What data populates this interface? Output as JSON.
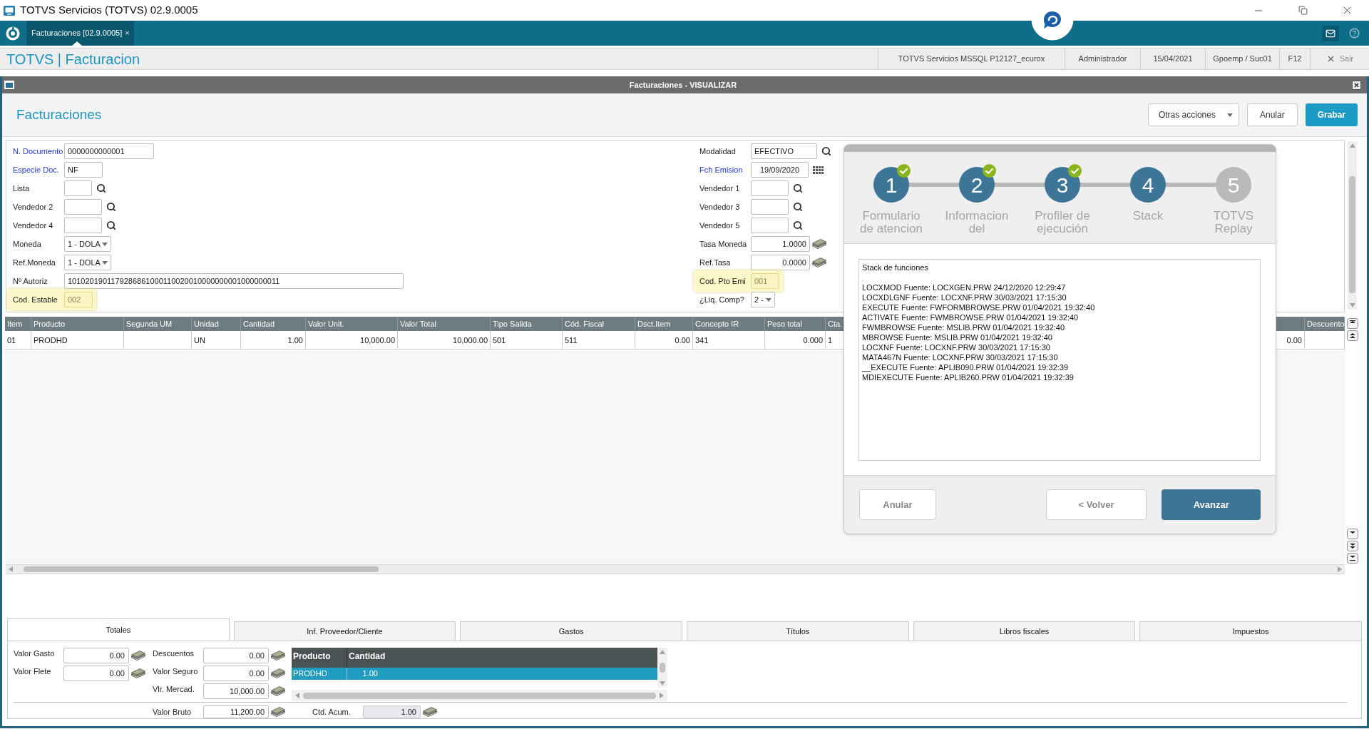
{
  "window": {
    "title": "TOTVS Servicios (TOTVS) 02.9.0005"
  },
  "app_tabs": [
    {
      "label": "Facturaciones [02.9.0005]",
      "close": "×",
      "selected": true
    }
  ],
  "app_header": {
    "title": "TOTVS | Facturacion",
    "info": [
      "TOTVS Servicios MSSQL P12127_ecurox",
      "Administrador",
      "15/04/2021",
      "Gpoemp / Suc01",
      "F12"
    ],
    "exit": "Sair"
  },
  "dialog": {
    "title": "Facturaciones - VISUALIZAR"
  },
  "page_header": {
    "title": "Facturaciones",
    "buttons": [
      {
        "label": "Otras acciones",
        "kind": "menu"
      },
      {
        "label": "Anular",
        "kind": "default"
      },
      {
        "label": "Grabar",
        "kind": "primary"
      }
    ]
  },
  "form": {
    "left": [
      {
        "label": "N. Documento",
        "value": "0000000000001",
        "kind": "text",
        "required": true,
        "highlighted": false
      },
      {
        "label": "Especie Doc.",
        "value": "NF",
        "kind": "text",
        "required": true,
        "highlighted": false
      },
      {
        "label": "Lista",
        "kind": "lookup",
        "required": false,
        "highlighted": false
      },
      {
        "label": "Vendedor 2",
        "kind": "lookup",
        "required": false,
        "highlighted": false
      },
      {
        "label": "Vendedor 4",
        "kind": "lookup",
        "required": false,
        "highlighted": false
      },
      {
        "label": "Moneda",
        "value": "1 - DOLA",
        "kind": "select",
        "required": false,
        "highlighted": false
      },
      {
        "label": "Ref.Moneda",
        "value": "1 - DOLA",
        "kind": "select",
        "required": false,
        "highlighted": false
      },
      {
        "label": "Nº Autoriz",
        "value": "1010201901179286861000110020010000000001000000011",
        "kind": "text",
        "required": false,
        "highlighted": false
      },
      {
        "label": "Cod. Estable",
        "value": "002",
        "kind": "text",
        "required": false,
        "highlighted": true
      }
    ],
    "right": [
      {
        "label": "Modalidad",
        "value": "EFECTIVO",
        "kind": "lookup",
        "required": false,
        "highlighted": false
      },
      {
        "label": "Fch Emision",
        "value": "19/09/2020",
        "kind": "date",
        "required": true,
        "highlighted": false
      },
      {
        "label": "Vendedor 1",
        "kind": "lookup",
        "required": false,
        "highlighted": false
      },
      {
        "label": "Vendedor 3",
        "kind": "lookup",
        "required": false,
        "highlighted": false
      },
      {
        "label": "Vendedor 5",
        "kind": "lookup",
        "required": false,
        "highlighted": false
      },
      {
        "label": "Tasa Moneda",
        "value": "1.0000",
        "kind": "amount",
        "required": false,
        "highlighted": false
      },
      {
        "label": "Ref.Tasa",
        "value": "0.0000",
        "kind": "amount",
        "required": false,
        "highlighted": false
      },
      {
        "label": "Cod. Pto Emi",
        "value": "001",
        "kind": "text",
        "required": false,
        "highlighted": true
      },
      {
        "label": "¿Liq. Comp?",
        "value": "2 -",
        "kind": "select",
        "required": false,
        "highlighted": false
      }
    ]
  },
  "items_table": {
    "columns": [
      {
        "label": "Item",
        "kind": "text"
      },
      {
        "label": "Producto",
        "kind": "text"
      },
      {
        "label": "Segunda UM",
        "kind": "text"
      },
      {
        "label": "Unidad",
        "kind": "text"
      },
      {
        "label": "Cantidad",
        "kind": "number"
      },
      {
        "label": "Valor Unit.",
        "kind": "number"
      },
      {
        "label": "Valor Total",
        "kind": "number"
      },
      {
        "label": "Tipo Salida",
        "kind": "text"
      },
      {
        "label": "Cód. Fiscal",
        "kind": "text"
      },
      {
        "label": "Dsct.Item",
        "kind": "number"
      },
      {
        "label": "Concepto IR",
        "kind": "text"
      },
      {
        "label": "Peso total",
        "kind": "number"
      },
      {
        "label": "Cta.",
        "kind": "text"
      },
      {
        "kind": "number"
      },
      {
        "label": "Descuento",
        "kind": "number"
      }
    ],
    "rows": [
      [
        "01",
        "PRODHD",
        null,
        "UN",
        "1.00",
        "10,000.00",
        "10,000.00",
        "501",
        "511",
        "0.00",
        "341",
        "0.000",
        "1",
        "0.00",
        null
      ]
    ]
  },
  "bottom_tabs": [
    {
      "label": "Totales",
      "selected": true
    },
    {
      "label": "Inf. Proveedor/Cliente",
      "selected": false
    },
    {
      "label": "Gastos",
      "selected": false
    },
    {
      "label": "Títulos",
      "selected": false
    },
    {
      "label": "Libros fiscales",
      "selected": false
    },
    {
      "label": "Impuestos",
      "selected": false
    }
  ],
  "totals": {
    "left": [
      {
        "label": "Valor Gasto",
        "value": "0.00"
      },
      {
        "label": "Valor Flete",
        "value": "0.00"
      }
    ],
    "middle": [
      {
        "label": "Descuentos",
        "value": "0.00"
      },
      {
        "label": "Valor Seguro",
        "value": "0.00"
      },
      {
        "label": "Vlr. Mercad.",
        "value": "10,000.00"
      }
    ],
    "grid": {
      "columns": [
        "Producto",
        "Cantidad"
      ],
      "rows": [
        {
          "cells": [
            "PRODHD",
            "1.00"
          ],
          "selected": true
        }
      ]
    },
    "summary": [
      {
        "label": "Valor Bruto",
        "value": "11,200.00",
        "disabled": false
      },
      {
        "label": "Ctd. Acum.",
        "value": "1.00",
        "disabled": true
      }
    ]
  },
  "wizard": {
    "steps": [
      {
        "number": "1",
        "label": "Formulario de atencion",
        "active": true,
        "completed": true
      },
      {
        "number": "2",
        "label": "Informacion del",
        "active": true,
        "completed": true
      },
      {
        "number": "3",
        "label": "Profiler de ejecución",
        "active": true,
        "completed": true
      },
      {
        "number": "4",
        "label": "Stack",
        "active": true,
        "completed": false
      },
      {
        "number": "5",
        "label": "TOTVS Replay",
        "active": false,
        "completed": false
      }
    ],
    "memo": {
      "title": "Stack de funciones",
      "lines": [
        "LOCXMOD Fuente: LOCXGEN.PRW 24/12/2020 12:29:47",
        "LOCXDLGNF Fuente: LOCXNF.PRW 30/03/2021 17:15:30",
        "EXECUTE Fuente: FWFORMBROWSE.PRW 01/04/2021 19:32:40",
        "ACTIVATE Fuente: FWMBROWSE.PRW 01/04/2021 19:32:40",
        "FWMBROWSE Fuente: MSLIB.PRW 01/04/2021 19:32:40",
        "MBROWSE Fuente: MSLIB.PRW 01/04/2021 19:32:40",
        "LOCXNF Fuente: LOCXNF.PRW 30/03/2021 17:15:30",
        "MATA467N Fuente: LOCXNF.PRW 30/03/2021 17:15:30",
        "__EXECUTE Fuente: APLIB090.PRW 01/04/2021 19:32:39",
        "MDIEXECUTE Fuente: APLIB260.PRW 01/04/2021 19:32:39"
      ]
    },
    "buttons": [
      {
        "label": "Anular",
        "kind": "default"
      },
      {
        "label": "< Volver",
        "kind": "default"
      },
      {
        "label": "Avanzar",
        "kind": "primary"
      }
    ]
  }
}
